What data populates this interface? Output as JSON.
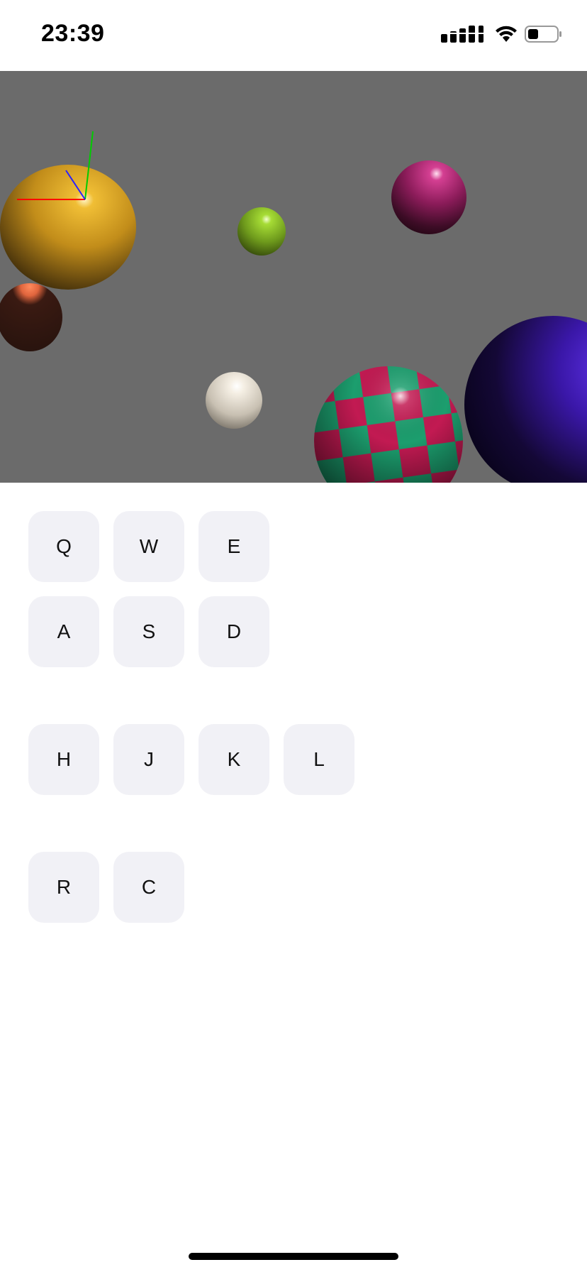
{
  "status_bar": {
    "time": "23:39",
    "signal_icon": "cellular-signal-icon",
    "wifi_icon": "wifi-icon",
    "battery_icon": "battery-icon",
    "battery_level": 0.35
  },
  "scene": {
    "background_color": "#6b6b6b",
    "axis_colors": {
      "x": "#ff0000",
      "y": "#00cc00",
      "z": "#0000ff"
    },
    "spheres": [
      {
        "name": "yellow-sphere",
        "color": "#d9a21e"
      },
      {
        "name": "orange-sphere",
        "color": "#ff7a4a"
      },
      {
        "name": "lime-sphere",
        "color": "#8ecb2a"
      },
      {
        "name": "magenta-sphere",
        "color": "#c2257e"
      },
      {
        "name": "white-sphere",
        "color": "#f2ece0"
      },
      {
        "name": "checkered-sphere",
        "colors": [
          "#c21a52",
          "#1c9e6e"
        ]
      },
      {
        "name": "blue-sphere",
        "color": "#4a1ec8"
      }
    ]
  },
  "keys": {
    "q": "Q",
    "w": "W",
    "e": "E",
    "a": "A",
    "s": "S",
    "d": "D",
    "h": "H",
    "j": "J",
    "k": "K",
    "l": "L",
    "r": "R",
    "c": "C"
  }
}
